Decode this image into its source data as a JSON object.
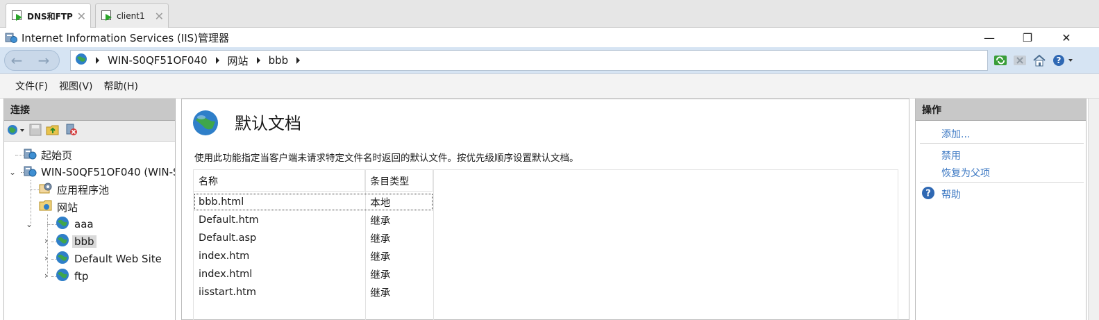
{
  "vm_tabs": [
    {
      "label": "DNS和FTP",
      "active": true
    },
    {
      "label": "client1",
      "active": false
    }
  ],
  "window": {
    "title": "Internet Information Services (IIS)管理器",
    "minimize": "—",
    "maximize": "❐",
    "close": "✕"
  },
  "address": {
    "back": "←",
    "forward": "→",
    "crumbs": [
      "WIN-S0QF51OF040",
      "网站",
      "bbb"
    ]
  },
  "menu": [
    "文件(F)",
    "视图(V)",
    "帮助(H)"
  ],
  "connections": {
    "title": "连接",
    "tree": [
      {
        "label": "起始页",
        "icon": "start-page-icon"
      },
      {
        "label": "WIN-S0QF51OF040 (WIN-S",
        "icon": "server-icon"
      },
      {
        "label": "应用程序池",
        "icon": "app-pool-icon"
      },
      {
        "label": "网站",
        "icon": "sites-folder-icon"
      },
      {
        "label": "aaa",
        "icon": "globe-icon"
      },
      {
        "label": "bbb",
        "icon": "globe-icon"
      },
      {
        "label": "Default Web Site",
        "icon": "globe-icon"
      },
      {
        "label": "ftp",
        "icon": "globe-icon"
      }
    ]
  },
  "feature": {
    "title": "默认文档",
    "description": "使用此功能指定当客户端未请求特定文件名时返回的默认文件。按优先级顺序设置默认文档。",
    "columns": [
      "名称",
      "条目类型"
    ],
    "rows": [
      {
        "name": "bbb.html",
        "type": "本地"
      },
      {
        "name": "Default.htm",
        "type": "继承"
      },
      {
        "name": "Default.asp",
        "type": "继承"
      },
      {
        "name": "index.htm",
        "type": "继承"
      },
      {
        "name": "index.html",
        "type": "继承"
      },
      {
        "name": "iisstart.htm",
        "type": "继承"
      }
    ]
  },
  "actions": {
    "title": "操作",
    "add": "添加...",
    "disable": "禁用",
    "revert": "恢复为父项",
    "help": "帮助"
  },
  "colors": {
    "accent": "#3c78c3",
    "address_bar": "#d6e4f3",
    "pane_header": "#c8c8c8"
  }
}
